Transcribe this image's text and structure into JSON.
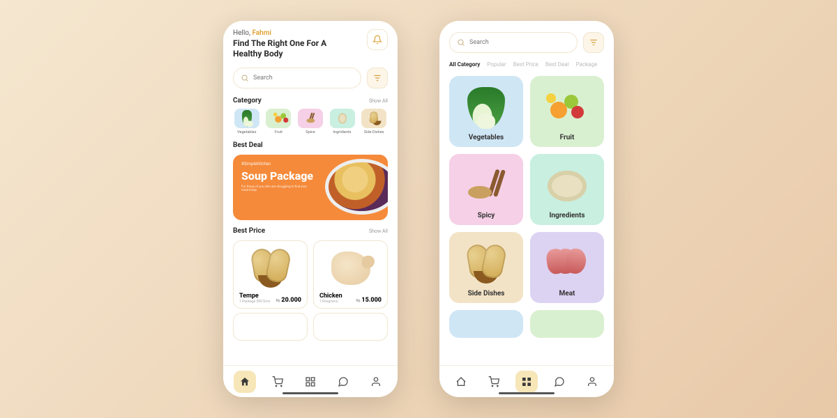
{
  "colors": {
    "accent": "#e0a030",
    "deal_bg": "#f58a3a"
  },
  "home": {
    "greeting_prefix": "Hello, ",
    "user_name": "Fahmi",
    "headline": "Find The Right One For A Healthy Body",
    "search_placeholder": "Search",
    "category_section": {
      "title": "Category",
      "show_all": "Show All"
    },
    "categories": [
      {
        "label": "Vegetables",
        "color": "c-blue"
      },
      {
        "label": "Fruit",
        "color": "c-green"
      },
      {
        "label": "Spice",
        "color": "c-pink"
      },
      {
        "label": "Ingridients",
        "color": "c-mint"
      },
      {
        "label": "Side Dishes",
        "color": "c-tan"
      }
    ],
    "best_deal": {
      "title": "Best Deal",
      "tag": "#SimpleKitchen",
      "cta_title": "Soup Package",
      "subtitle": "For those of you who are struggling to find your meal today"
    },
    "best_price": {
      "title": "Best Price",
      "show_all": "Show All",
      "items": [
        {
          "name": "Tempe",
          "subtitle": "1 Package 500 Gms",
          "currency": "Rp",
          "price": "20.000"
        },
        {
          "name": "Chicken",
          "subtitle": "1 Kilograms",
          "currency": "Rp",
          "price": "15.000"
        }
      ]
    },
    "nav_active_index": 0
  },
  "catalog": {
    "search_placeholder": "Search",
    "tabs": [
      "All Category",
      "Popular",
      "Best Price",
      "Best Deal",
      "Package"
    ],
    "active_tab": 0,
    "tiles": [
      {
        "label": "Vegetables",
        "color": "c-blue"
      },
      {
        "label": "Fruit",
        "color": "c-green"
      },
      {
        "label": "Spicy",
        "color": "c-pink"
      },
      {
        "label": "Ingredients",
        "color": "c-mint"
      },
      {
        "label": "Side Dishes",
        "color": "c-tan"
      },
      {
        "label": "Meat",
        "color": "c-violet"
      }
    ],
    "nav_active_index": 2
  },
  "nav_icons": [
    "home",
    "cart",
    "grid",
    "chat",
    "profile"
  ]
}
